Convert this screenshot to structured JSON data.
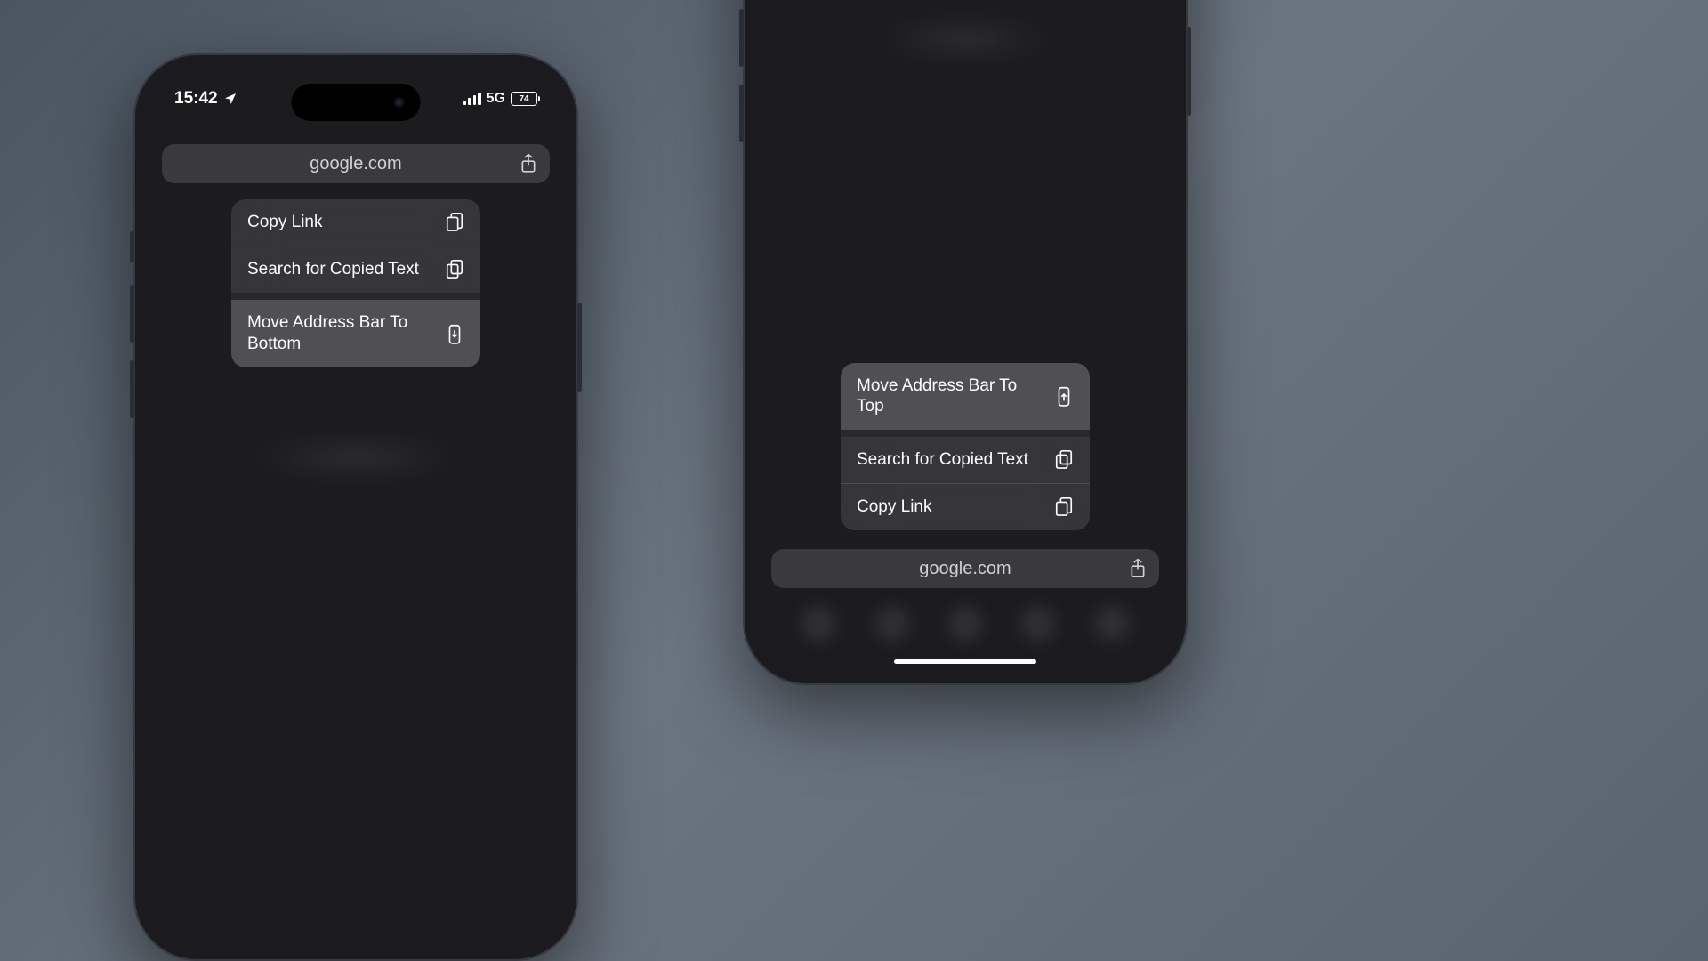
{
  "status": {
    "time": "15:42",
    "network": "5G",
    "battery": "74"
  },
  "address": {
    "url": "google.com"
  },
  "phone_left": {
    "menu": {
      "copy_link": "Copy Link",
      "search_copied": "Search for Copied Text",
      "move_bar": "Move Address Bar To Bottom"
    }
  },
  "phone_right": {
    "menu": {
      "move_bar": "Move Address Bar To Top",
      "search_copied": "Search for Copied Text",
      "copy_link": "Copy Link"
    }
  }
}
